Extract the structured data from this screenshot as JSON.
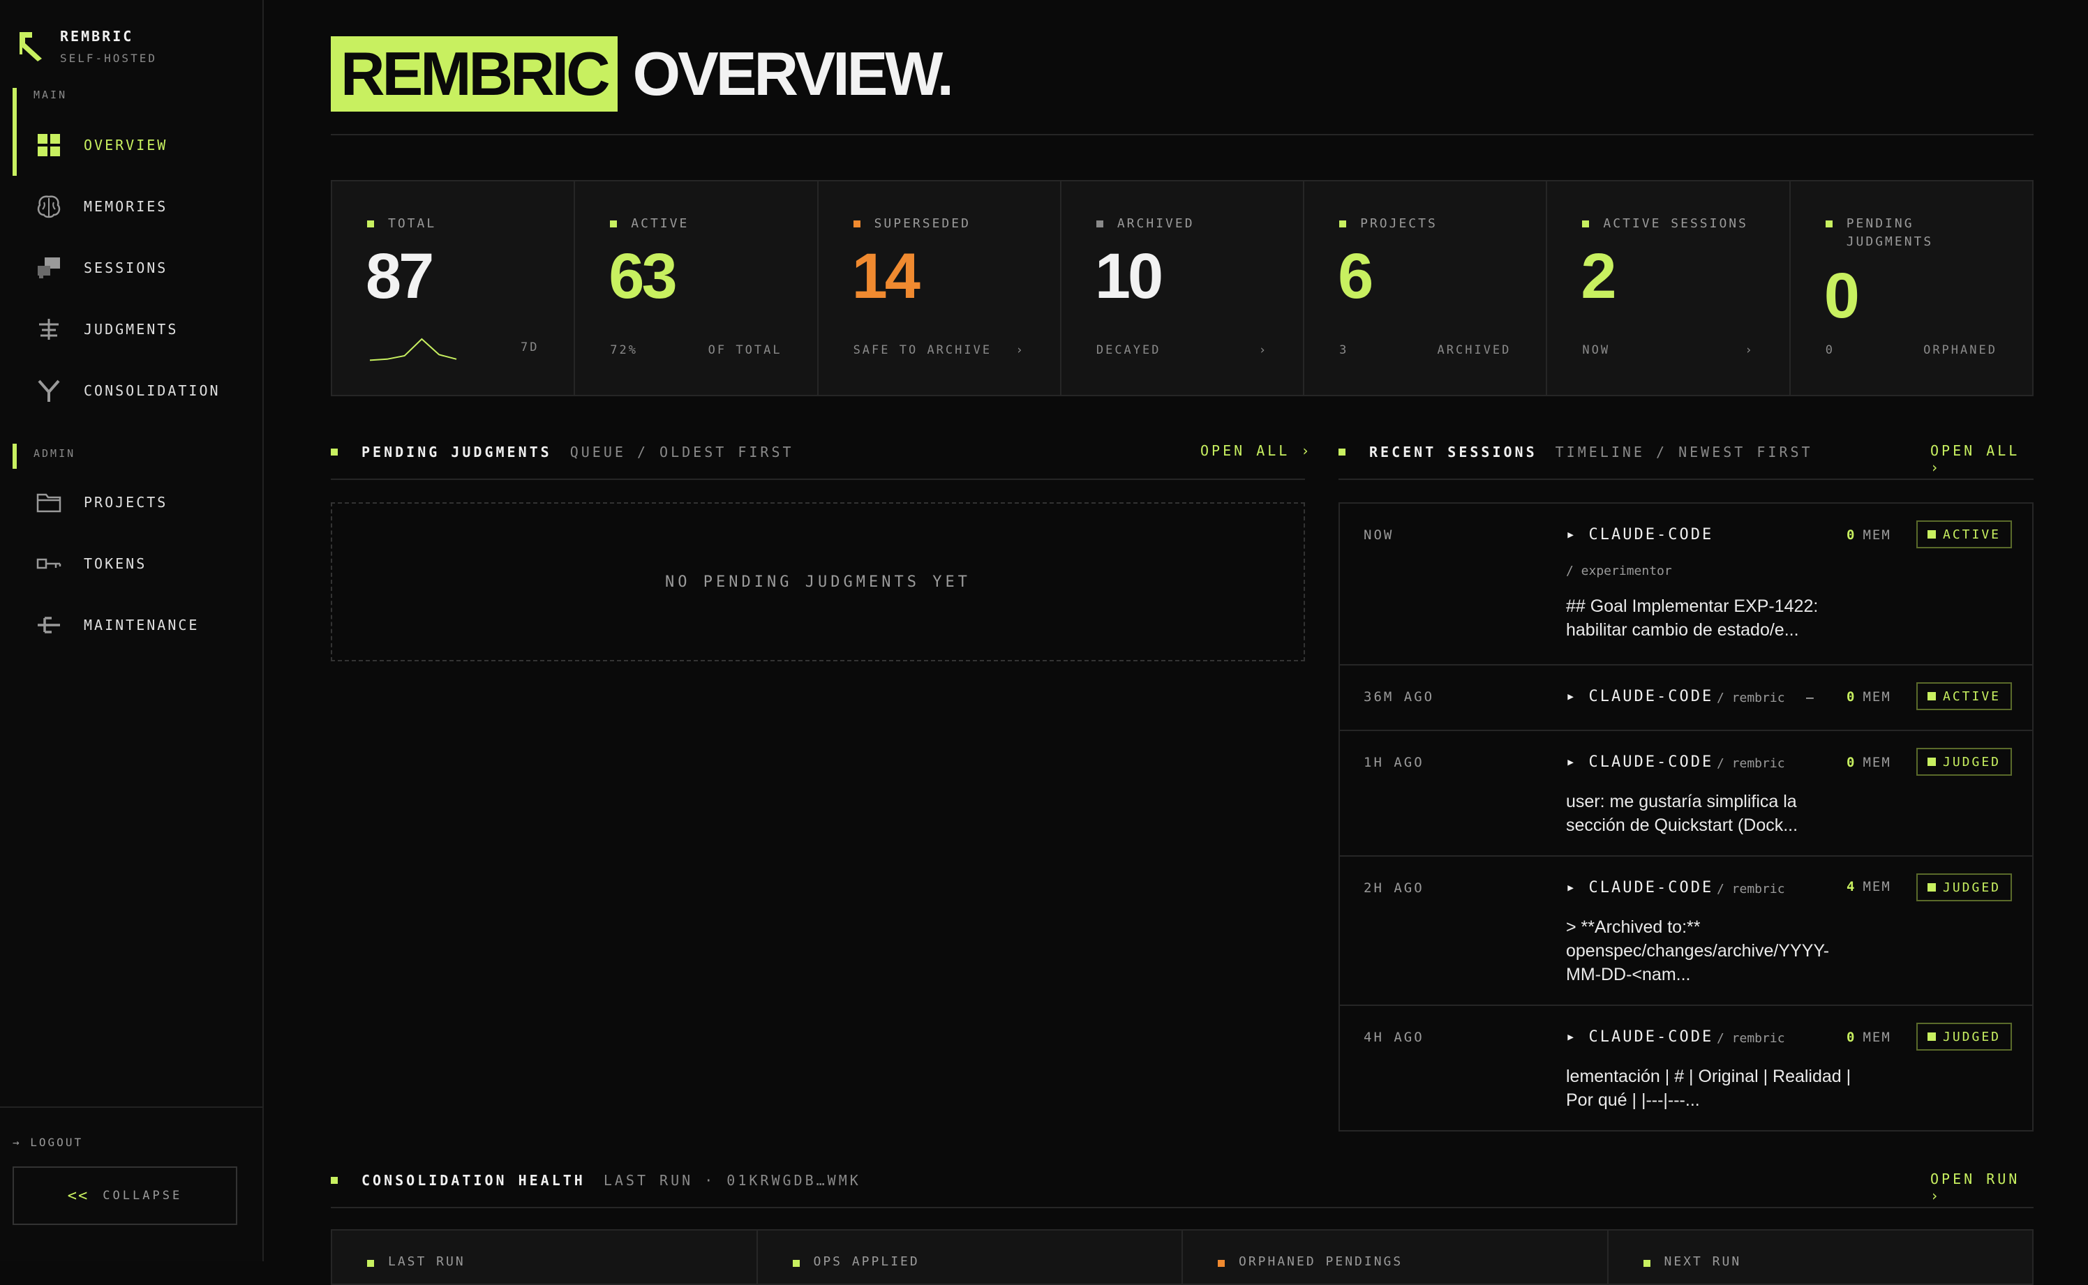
{
  "brand": {
    "name": "REMBRIC",
    "sub": "SELF-HOSTED"
  },
  "sidebar": {
    "section_main": "MAIN",
    "section_admin": "ADMIN",
    "main_items": [
      {
        "label": "OVERVIEW",
        "icon": "grid-icon",
        "active": true
      },
      {
        "label": "MEMORIES",
        "icon": "brain-icon"
      },
      {
        "label": "SESSIONS",
        "icon": "windows-icon"
      },
      {
        "label": "JUDGMENTS",
        "icon": "scales-icon"
      },
      {
        "label": "CONSOLIDATION",
        "icon": "merge-icon"
      }
    ],
    "admin_items": [
      {
        "label": "PROJECTS",
        "icon": "folder-icon"
      },
      {
        "label": "TOKENS",
        "icon": "key-icon"
      },
      {
        "label": "MAINTENANCE",
        "icon": "wrench-icon"
      }
    ],
    "logout": "LOGOUT",
    "collapse": "COLLAPSE",
    "collapse_glyph": "<<"
  },
  "header": {
    "highlight": "REMBRIC",
    "rest": "OVERVIEW."
  },
  "stats": [
    {
      "label": "TOTAL",
      "value": "87",
      "foot_left": "",
      "foot_right": "7D",
      "color": "#f2f2f2",
      "dot": "#c8f060"
    },
    {
      "label": "ACTIVE",
      "value": "63",
      "foot_left": "72%",
      "foot_right": "OF TOTAL",
      "color": "#c8f060",
      "dot": "#c8f060"
    },
    {
      "label": "SUPERSEDED",
      "value": "14",
      "foot_left": "SAFE TO ARCHIVE",
      "foot_right": "›",
      "color": "#f08a30",
      "dot": "#f08a30"
    },
    {
      "label": "ARCHIVED",
      "value": "10",
      "foot_left": "DECAYED",
      "foot_right": "›",
      "color": "#f2f2f2",
      "dot": "#8a8a8a"
    },
    {
      "label": "PROJECTS",
      "value": "6",
      "foot_left": "3",
      "foot_right": "ARCHIVED",
      "color": "#c8f060",
      "dot": "#c8f060"
    },
    {
      "label": "ACTIVE SESSIONS",
      "value": "2",
      "foot_left": "NOW",
      "foot_right": "›",
      "color": "#c8f060",
      "dot": "#c8f060"
    },
    {
      "label": "PENDING JUDGMENTS",
      "value": "0",
      "foot_left": "0",
      "foot_right": "ORPHANED",
      "color": "#c8f060",
      "dot": "#c8f060"
    }
  ],
  "sparkline": [
    0.05,
    0.1,
    0.25,
    1.0,
    0.3,
    0.1
  ],
  "pending": {
    "title": "PENDING JUDGMENTS",
    "subtitle": "QUEUE / OLDEST FIRST",
    "open_all": "OPEN ALL ›",
    "empty": "NO PENDING JUDGMENTS YET"
  },
  "recent": {
    "title": "RECENT SESSIONS",
    "subtitle": "TIMELINE / NEWEST FIRST",
    "open_all": "OPEN ALL ›",
    "rows": [
      {
        "time": "NOW",
        "agent": "▸ CLAUDE-CODE",
        "project": "/ experimentor",
        "mem_count": "0",
        "mem_label": "MEM",
        "status": "ACTIVE",
        "desc": "## Goal Implementar EXP-1422: habilitar cambio de estado/e..."
      },
      {
        "time": "36M AGO",
        "agent": "▸ CLAUDE-CODE",
        "project": "/ rembric",
        "dash": "—",
        "mem_count": "0",
        "mem_label": "MEM",
        "status": "ACTIVE",
        "desc": ""
      },
      {
        "time": "1H AGO",
        "agent": "▸ CLAUDE-CODE",
        "project": "/ rembric",
        "mem_count": "0",
        "mem_label": "MEM",
        "status": "JUDGED",
        "desc": "user: me gustaría simplifica la sección de Quickstart (Dock..."
      },
      {
        "time": "2H AGO",
        "agent": "▸ CLAUDE-CODE",
        "project": "/ rembric",
        "mem_count": "4",
        "mem_label": "MEM",
        "status": "JUDGED",
        "desc": "> **Archived to:** openspec/changes/archive/YYYY-MM-DD-<nam..."
      },
      {
        "time": "4H AGO",
        "agent": "▸ CLAUDE-CODE",
        "project": "/ rembric",
        "mem_count": "0",
        "mem_label": "MEM",
        "status": "JUDGED",
        "desc": "lementación | # | Original | Realidad | Por qué | |---|---..."
      }
    ]
  },
  "consolidation": {
    "title": "CONSOLIDATION HEALTH",
    "subtitle": "LAST RUN · 01KRWGDB…WMK",
    "open_run": "OPEN RUN ›",
    "cards": [
      "LAST RUN",
      "OPS APPLIED",
      "ORPHANED PENDINGS",
      "NEXT RUN"
    ]
  },
  "colors": {
    "accent": "#c8f060",
    "orange": "#f08a30",
    "bg": "#0a0a0a"
  }
}
